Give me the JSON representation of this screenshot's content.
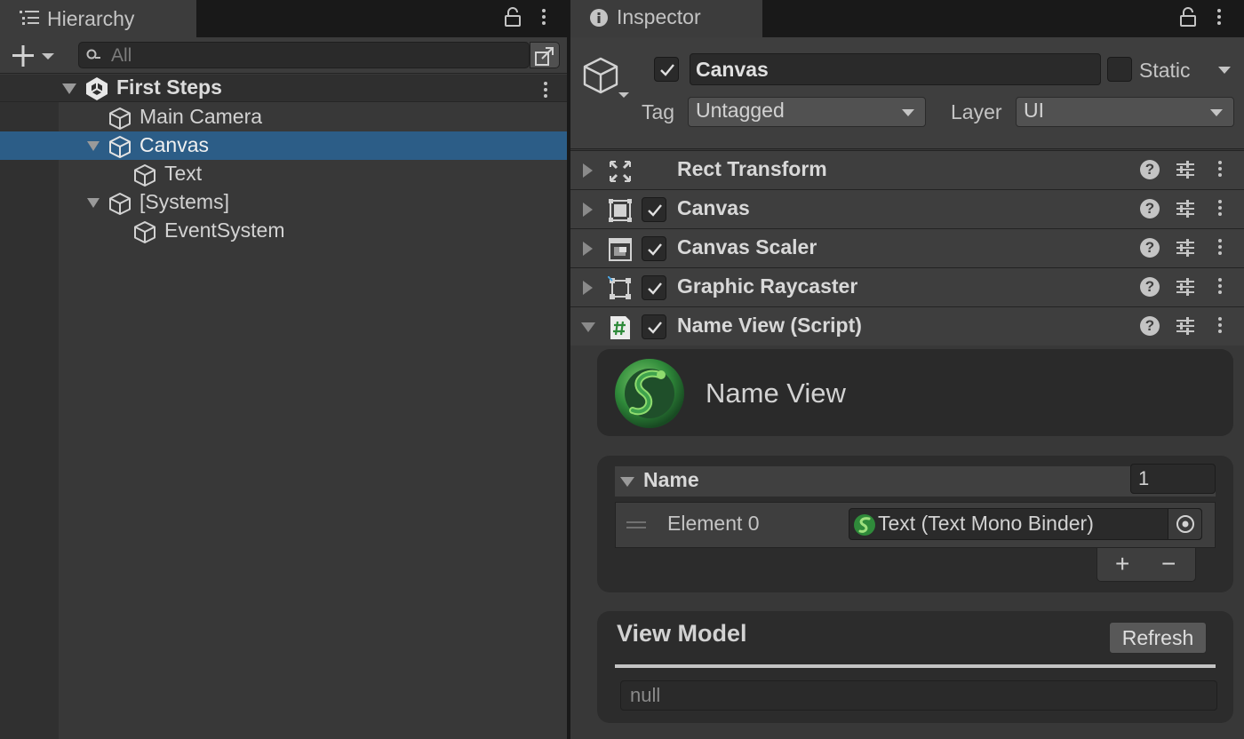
{
  "hierarchy": {
    "tab_title": "Hierarchy",
    "search_placeholder": "All",
    "scene_name": "First Steps",
    "items": [
      {
        "label": "Main Camera"
      },
      {
        "label": "Canvas"
      },
      {
        "label": "Text"
      },
      {
        "label": "[Systems]"
      },
      {
        "label": "EventSystem"
      }
    ],
    "selected_item": "Canvas"
  },
  "inspector": {
    "tab_title": "Inspector",
    "object_name": "Canvas",
    "object_active": true,
    "static_label": "Static",
    "static_checked": false,
    "tag_label": "Tag",
    "tag_value": "Untagged",
    "layer_label": "Layer",
    "layer_value": "UI",
    "components": [
      {
        "title": "Rect Transform",
        "icon": "rect-transform-icon",
        "has_checkbox": false,
        "expanded": false
      },
      {
        "title": "Canvas",
        "icon": "canvas-icon",
        "has_checkbox": true,
        "expanded": false
      },
      {
        "title": "Canvas Scaler",
        "icon": "canvas-scaler-icon",
        "has_checkbox": true,
        "expanded": false
      },
      {
        "title": "Graphic Raycaster",
        "icon": "graphic-raycaster-icon",
        "has_checkbox": true,
        "expanded": false
      },
      {
        "title": "Name View (Script)",
        "icon": "script-hash-icon",
        "has_checkbox": true,
        "expanded": true
      }
    ],
    "script": {
      "banner_title": "Name View",
      "list_name": "Name",
      "list_size": "1",
      "element_label": "Element 0",
      "element_value": "Text (Text Mono Binder)",
      "add_label": "+",
      "remove_label": "−",
      "view_model_title": "View Model",
      "refresh_label": "Refresh",
      "view_model_value": "null"
    }
  },
  "colors": {
    "panel_bg": "#383838",
    "selection": "#2c5d87",
    "tab_bar": "#191919",
    "logo_green": "#3fa34d"
  }
}
